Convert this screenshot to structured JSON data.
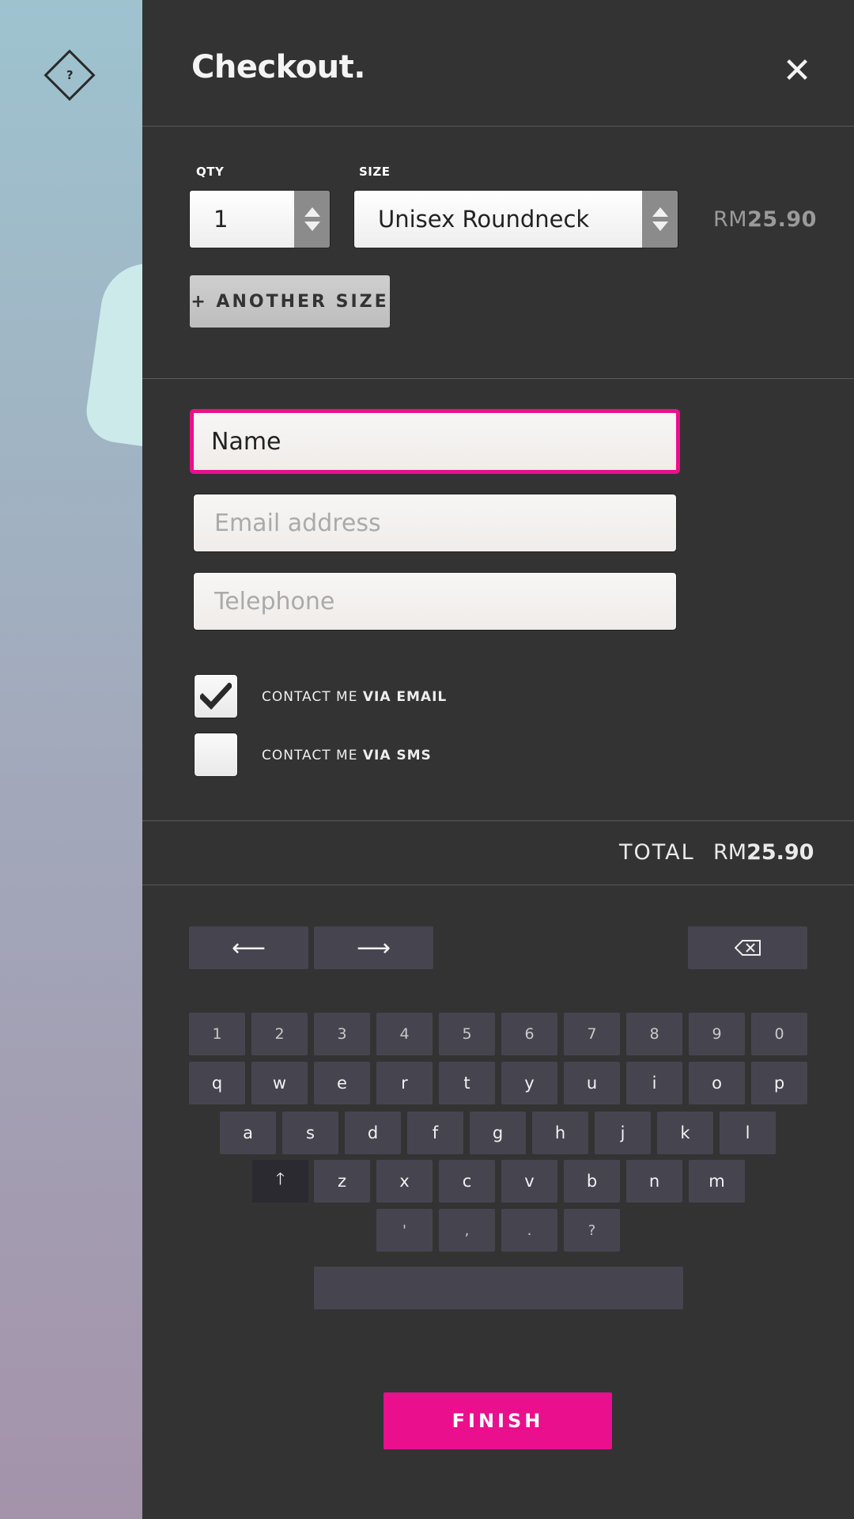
{
  "colors": {
    "accent": "#ea0f8c",
    "panel": "#333333",
    "key": "#46454f"
  },
  "help": {
    "icon": "help-diamond-icon",
    "glyph": "?"
  },
  "header": {
    "title": "Checkout.",
    "close_glyph": "✕"
  },
  "order": {
    "qty_label": "QTY",
    "qty_value": "1",
    "size_label": "SIZE",
    "size_value": "Unisex Roundneck",
    "price_currency": "RM",
    "price_amount": "25.90",
    "another_size": "+ ANOTHER SIZE"
  },
  "form": {
    "name_value": "Name",
    "email_placeholder": "Email address",
    "telephone_placeholder": "Telephone"
  },
  "contact": {
    "email_prefix": "CONTACT ME ",
    "email_bold": "VIA EMAIL",
    "email_checked": true,
    "sms_prefix": "CONTACT ME ",
    "sms_bold": "VIA SMS",
    "sms_checked": false
  },
  "total": {
    "label": "TOTAL",
    "currency": "RM",
    "amount": "25.90"
  },
  "keyboard": {
    "left_arrow": "⟵",
    "right_arrow": "⟶",
    "backspace_icon": "backspace-icon",
    "numbers": [
      "1",
      "2",
      "3",
      "4",
      "5",
      "6",
      "7",
      "8",
      "9",
      "0"
    ],
    "row1": [
      "q",
      "w",
      "e",
      "r",
      "t",
      "y",
      "u",
      "i",
      "o",
      "p"
    ],
    "row2": [
      "a",
      "s",
      "d",
      "f",
      "g",
      "h",
      "j",
      "k",
      "l"
    ],
    "shift_glyph": "🡑",
    "row3": [
      "z",
      "x",
      "c",
      "v",
      "b",
      "n",
      "m"
    ],
    "punct": [
      "'",
      ",",
      ".",
      "?"
    ]
  },
  "finish_label": "FINISH"
}
